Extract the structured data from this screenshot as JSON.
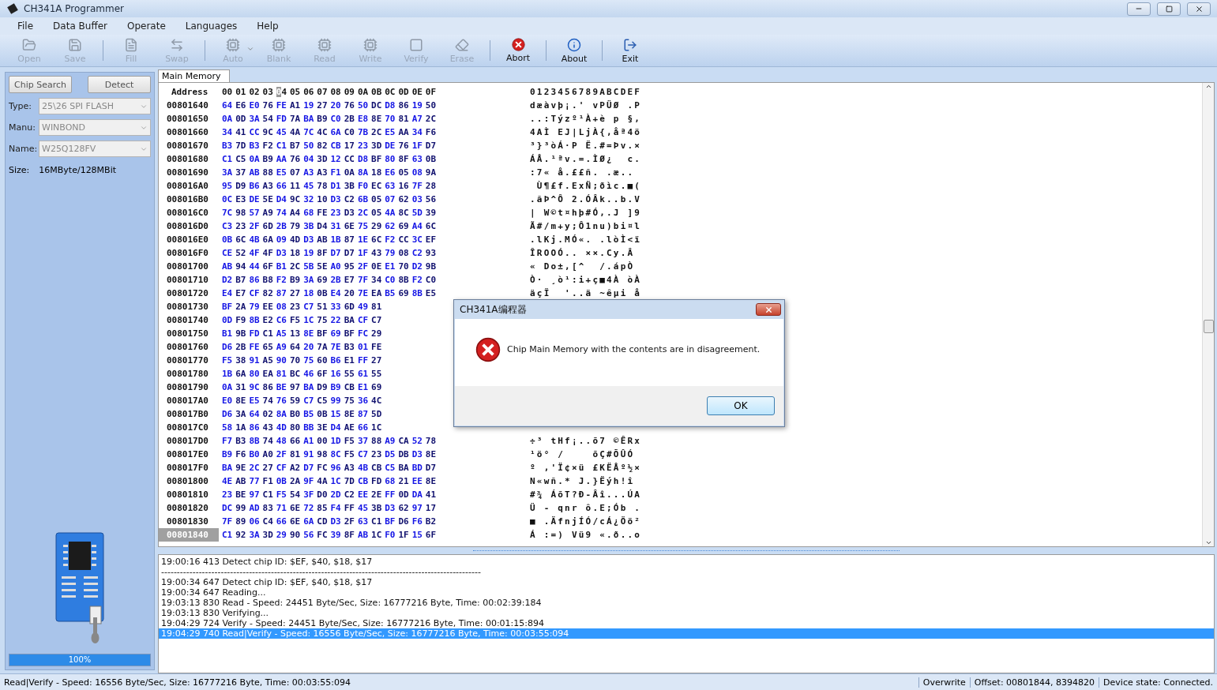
{
  "window": {
    "title": "CH341A Programmer"
  },
  "menu": [
    "File",
    "Data Buffer",
    "Operate",
    "Languages",
    "Help"
  ],
  "toolbar": {
    "groups": [
      {
        "buttons": [
          {
            "label": "Open",
            "disabled": true,
            "kind": "button"
          },
          {
            "label": "Save",
            "disabled": true,
            "kind": "button"
          }
        ]
      },
      {
        "buttons": [
          {
            "label": "Fill",
            "disabled": true,
            "kind": "button"
          },
          {
            "label": "Swap",
            "disabled": true,
            "kind": "button"
          }
        ]
      },
      {
        "buttons": [
          {
            "label": "Auto",
            "disabled": true,
            "kind": "dropdown"
          },
          {
            "label": "Blank",
            "disabled": true,
            "kind": "button"
          },
          {
            "label": "Read",
            "disabled": true,
            "kind": "button"
          },
          {
            "label": "Write",
            "disabled": true,
            "kind": "button"
          },
          {
            "label": "Verify",
            "disabled": true,
            "kind": "button"
          },
          {
            "label": "Erase",
            "disabled": true,
            "kind": "button"
          }
        ]
      },
      {
        "buttons": [
          {
            "label": "Abort",
            "disabled": false,
            "kind": "button"
          }
        ]
      },
      {
        "buttons": [
          {
            "label": "About",
            "disabled": false,
            "kind": "button"
          }
        ]
      },
      {
        "buttons": [
          {
            "label": "Exit",
            "disabled": false,
            "kind": "button"
          }
        ]
      }
    ]
  },
  "chip_panel": {
    "buttons": [
      "Chip Search",
      "Detect"
    ],
    "fields": [
      {
        "label": "Type:",
        "value": "25\\26 SPI FLASH",
        "disabled": true
      },
      {
        "label": "Manu:",
        "value": "WINBOND",
        "disabled": true
      },
      {
        "label": "Name:",
        "value": "W25Q128FV",
        "disabled": true
      }
    ],
    "size_label": "Size:",
    "size_value": "16MByte/128MBit",
    "progress": {
      "level": 1,
      "reading": "100%"
    }
  },
  "hex_view": {
    "tab": "Main Memory",
    "address_header": "Address",
    "ascii_header": "0123456789ABCDEF",
    "columns": [
      {
        "label": "00",
        "cursor": false
      },
      {
        "label": "01",
        "cursor": false
      },
      {
        "label": "02",
        "cursor": false
      },
      {
        "label": "03",
        "cursor": false
      },
      {
        "label": "04",
        "cursor": true
      },
      {
        "label": "05",
        "cursor": false
      },
      {
        "label": "06",
        "cursor": false
      },
      {
        "label": "07",
        "cursor": false
      },
      {
        "label": "08",
        "cursor": false
      },
      {
        "label": "09",
        "cursor": false
      },
      {
        "label": "0A",
        "cursor": false
      },
      {
        "label": "0B",
        "cursor": false
      },
      {
        "label": "0C",
        "cursor": false
      },
      {
        "label": "0D",
        "cursor": false
      },
      {
        "label": "0E",
        "cursor": false
      },
      {
        "label": "0F",
        "cursor": false
      }
    ],
    "rows": [
      {
        "address": "00801640",
        "selected": false,
        "bytes": [
          "64",
          "E6",
          "E0",
          "76",
          "FE",
          "A1",
          "19",
          "27",
          "20",
          "76",
          "50",
          "DC",
          "D8",
          "86",
          "19",
          "50"
        ],
        "ascii": "dæàvþ¡.' vPÜØ .P"
      },
      {
        "address": "00801650",
        "selected": false,
        "bytes": [
          "0A",
          "0D",
          "3A",
          "54",
          "FD",
          "7A",
          "BA",
          "B9",
          "C0",
          "2B",
          "E8",
          "8E",
          "70",
          "81",
          "A7",
          "2C"
        ],
        "ascii": "..:Týzº¹À+è p §,"
      },
      {
        "address": "00801660",
        "selected": false,
        "bytes": [
          "34",
          "41",
          "CC",
          "9C",
          "45",
          "4A",
          "7C",
          "4C",
          "6A",
          "C0",
          "7B",
          "2C",
          "E5",
          "AA",
          "34",
          "F6"
        ],
        "ascii": "4AÌ EJ|LjÀ{,åª4ö"
      },
      {
        "address": "00801670",
        "selected": false,
        "bytes": [
          "B3",
          "7D",
          "B3",
          "F2",
          "C1",
          "B7",
          "50",
          "82",
          "CB",
          "17",
          "23",
          "3D",
          "DE",
          "76",
          "1F",
          "D7"
        ],
        "ascii": "³}³òÁ·P Ë.#=Þv.×"
      },
      {
        "address": "00801680",
        "selected": false,
        "bytes": [
          "C1",
          "C5",
          "0A",
          "B9",
          "AA",
          "76",
          "04",
          "3D",
          "12",
          "CC",
          "D8",
          "BF",
          "80",
          "8F",
          "63",
          "0B"
        ],
        "ascii": "ÁÅ.¹ªv.=.ÌØ¿  c."
      },
      {
        "address": "00801690",
        "selected": false,
        "bytes": [
          "3A",
          "37",
          "AB",
          "88",
          "E5",
          "07",
          "A3",
          "A3",
          "F1",
          "0A",
          "8A",
          "18",
          "E6",
          "05",
          "08",
          "9A"
        ],
        "ascii": ":7« å.££ñ. .æ.."
      },
      {
        "address": "008016A0",
        "selected": false,
        "bytes": [
          "95",
          "D9",
          "B6",
          "A3",
          "66",
          "11",
          "45",
          "78",
          "D1",
          "3B",
          "F0",
          "EC",
          "63",
          "16",
          "7F",
          "28"
        ],
        "ascii": " Ù¶£f.ExÑ;ðìc.■("
      },
      {
        "address": "008016B0",
        "selected": false,
        "bytes": [
          "0C",
          "E3",
          "DE",
          "5E",
          "D4",
          "9C",
          "32",
          "10",
          "D3",
          "C2",
          "6B",
          "05",
          "07",
          "62",
          "03",
          "56"
        ],
        "ascii": ".ãÞ^Ô 2.ÓÂk..b.V"
      },
      {
        "address": "008016C0",
        "selected": false,
        "bytes": [
          "7C",
          "98",
          "57",
          "A9",
          "74",
          "A4",
          "68",
          "FE",
          "23",
          "D3",
          "2C",
          "05",
          "4A",
          "8C",
          "5D",
          "39"
        ],
        "ascii": "| W©t¤hþ#Ó,.J ]9"
      },
      {
        "address": "008016D0",
        "selected": false,
        "bytes": [
          "C3",
          "23",
          "2F",
          "6D",
          "2B",
          "79",
          "3B",
          "D4",
          "31",
          "6E",
          "75",
          "29",
          "62",
          "69",
          "A4",
          "6C"
        ],
        "ascii": "Ã#/m+y;Ô1nu)bi¤l"
      },
      {
        "address": "008016E0",
        "selected": false,
        "bytes": [
          "0B",
          "6C",
          "4B",
          "6A",
          "09",
          "4D",
          "D3",
          "AB",
          "1B",
          "87",
          "1E",
          "6C",
          "F2",
          "CC",
          "3C",
          "EF"
        ],
        "ascii": ".lKj.MÓ«. .lòÌ<ï"
      },
      {
        "address": "008016F0",
        "selected": false,
        "bytes": [
          "CE",
          "52",
          "4F",
          "4F",
          "D3",
          "18",
          "19",
          "8F",
          "D7",
          "D7",
          "1F",
          "43",
          "79",
          "08",
          "C2",
          "93"
        ],
        "ascii": "ÎROOÓ.. ××.Cy.Â"
      },
      {
        "address": "00801700",
        "selected": false,
        "bytes": [
          "AB",
          "94",
          "44",
          "6F",
          "B1",
          "2C",
          "5B",
          "5E",
          "A0",
          "95",
          "2F",
          "0E",
          "E1",
          "70",
          "D2",
          "9B"
        ],
        "ascii": "« Do±,[^  /.ápÒ"
      },
      {
        "address": "00801710",
        "selected": false,
        "bytes": [
          "D2",
          "B7",
          "86",
          "B8",
          "F2",
          "B9",
          "3A",
          "69",
          "2B",
          "E7",
          "7F",
          "34",
          "C0",
          "8B",
          "F2",
          "C0"
        ],
        "ascii": "Ò· ¸ò¹:i+ç■4À òÀ"
      },
      {
        "address": "00801720",
        "selected": false,
        "bytes": [
          "E4",
          "E7",
          "CF",
          "82",
          "87",
          "27",
          "18",
          "0B",
          "E4",
          "20",
          "7E",
          "EA",
          "B5",
          "69",
          "8B",
          "E5"
        ],
        "ascii": "äçÏ  '..ä ~êµi å"
      },
      {
        "address": "00801730",
        "selected": false,
        "bytes": [
          "BF",
          "2A",
          "79",
          "EE",
          "08",
          "23",
          "C7",
          "51",
          "33",
          "6D",
          "49",
          "81"
        ]
      },
      {
        "address": "00801740",
        "selected": false,
        "bytes": [
          "0D",
          "F9",
          "8B",
          "E2",
          "C6",
          "F5",
          "1C",
          "75",
          "22",
          "BA",
          "CF",
          "C7"
        ]
      },
      {
        "address": "00801750",
        "selected": false,
        "bytes": [
          "B1",
          "9B",
          "FD",
          "C1",
          "A5",
          "13",
          "8E",
          "BF",
          "69",
          "BF",
          "FC",
          "29"
        ]
      },
      {
        "address": "00801760",
        "selected": false,
        "bytes": [
          "D6",
          "2B",
          "FE",
          "65",
          "A9",
          "64",
          "20",
          "7A",
          "7E",
          "B3",
          "01",
          "FE"
        ]
      },
      {
        "address": "00801770",
        "selected": false,
        "bytes": [
          "F5",
          "38",
          "91",
          "A5",
          "90",
          "70",
          "75",
          "60",
          "B6",
          "E1",
          "FF",
          "27"
        ]
      },
      {
        "address": "00801780",
        "selected": false,
        "bytes": [
          "1B",
          "6A",
          "80",
          "EA",
          "81",
          "BC",
          "46",
          "6F",
          "16",
          "55",
          "61",
          "55"
        ]
      },
      {
        "address": "00801790",
        "selected": false,
        "bytes": [
          "0A",
          "31",
          "9C",
          "86",
          "BE",
          "97",
          "BA",
          "D9",
          "B9",
          "CB",
          "E1",
          "69"
        ]
      },
      {
        "address": "008017A0",
        "selected": false,
        "bytes": [
          "E0",
          "8E",
          "E5",
          "74",
          "76",
          "59",
          "C7",
          "C5",
          "99",
          "75",
          "36",
          "4C"
        ]
      },
      {
        "address": "008017B0",
        "selected": false,
        "bytes": [
          "D6",
          "3A",
          "64",
          "02",
          "8A",
          "B0",
          "B5",
          "0B",
          "15",
          "8E",
          "87",
          "5D"
        ]
      },
      {
        "address": "008017C0",
        "selected": false,
        "bytes": [
          "58",
          "1A",
          "86",
          "43",
          "4D",
          "80",
          "BB",
          "3E",
          "D4",
          "AE",
          "66",
          "1C"
        ]
      },
      {
        "address": "008017D0",
        "selected": false,
        "bytes": [
          "F7",
          "B3",
          "8B",
          "74",
          "48",
          "66",
          "A1",
          "00",
          "1D",
          "F5",
          "37",
          "88",
          "A9",
          "CA",
          "52",
          "78"
        ],
        "ascii": "÷³ tHf¡..õ7 ©ÊRx"
      },
      {
        "address": "008017E0",
        "selected": false,
        "bytes": [
          "B9",
          "F6",
          "B0",
          "A0",
          "2F",
          "81",
          "91",
          "98",
          "8C",
          "F5",
          "C7",
          "23",
          "D5",
          "DB",
          "D3",
          "8E"
        ],
        "ascii": "¹ö° /    õÇ#ÕÛÓ"
      },
      {
        "address": "008017F0",
        "selected": false,
        "bytes": [
          "BA",
          "9E",
          "2C",
          "27",
          "CF",
          "A2",
          "D7",
          "FC",
          "96",
          "A3",
          "4B",
          "CB",
          "C5",
          "BA",
          "BD",
          "D7"
        ],
        "ascii": "º ,'Ï¢×ü £KËÅº½×"
      },
      {
        "address": "00801800",
        "selected": false,
        "bytes": [
          "4E",
          "AB",
          "77",
          "F1",
          "0B",
          "2A",
          "9F",
          "4A",
          "1C",
          "7D",
          "CB",
          "FD",
          "68",
          "21",
          "EE",
          "8E"
        ],
        "ascii": "N«wñ.* J.}Ëýh!î"
      },
      {
        "address": "00801810",
        "selected": false,
        "bytes": [
          "23",
          "BE",
          "97",
          "C1",
          "F5",
          "54",
          "3F",
          "D0",
          "2D",
          "C2",
          "EE",
          "2E",
          "FF",
          "0D",
          "DA",
          "41"
        ],
        "ascii": "#¾ ÁõT?Ð-Âî...ÚA"
      },
      {
        "address": "00801820",
        "selected": false,
        "bytes": [
          "DC",
          "99",
          "AD",
          "83",
          "71",
          "6E",
          "72",
          "85",
          "F4",
          "FF",
          "45",
          "3B",
          "D3",
          "62",
          "97",
          "17"
        ],
        "ascii": "Ü - qnr ô.E;Ób ."
      },
      {
        "address": "00801830",
        "selected": false,
        "bytes": [
          "7F",
          "89",
          "06",
          "C4",
          "66",
          "6E",
          "6A",
          "CD",
          "D3",
          "2F",
          "63",
          "C1",
          "BF",
          "D6",
          "F6",
          "B2"
        ],
        "ascii": "■ .ÄfnjÍÓ/cÁ¿Öö²"
      },
      {
        "address": "00801840",
        "selected": true,
        "bytes": [
          "C1",
          "92",
          "3A",
          "3D",
          "29",
          "90",
          "56",
          "FC",
          "39",
          "8F",
          "AB",
          "1C",
          "F0",
          "1F",
          "15",
          "6F"
        ],
        "ascii": "Á :=) Vü9 «.ð..o"
      }
    ]
  },
  "log": [
    {
      "text": "19:00:16 413 Detect chip ID: $EF, $40, $18, $17",
      "selected": false
    },
    {
      "text": "------------------------------------------------------------------------------------------------------",
      "selected": false
    },
    {
      "text": "19:00:34 647 Detect chip ID: $EF, $40, $18, $17",
      "selected": false
    },
    {
      "text": "19:00:34 647 Reading...",
      "selected": false
    },
    {
      "text": "19:03:13 830 Read - Speed: 24451 Byte/Sec, Size: 16777216 Byte, Time: 00:02:39:184",
      "selected": false
    },
    {
      "text": "19:03:13 830 Verifying...",
      "selected": false
    },
    {
      "text": "19:04:29 724 Verify - Speed: 24451 Byte/Sec, Size: 16777216 Byte, Time: 00:01:15:894",
      "selected": false
    },
    {
      "text": "19:04:29 740 Read|Verify - Speed: 16556 Byte/Sec, Size: 16777216 Byte, Time: 00:03:55:094",
      "selected": true
    }
  ],
  "status_bar": [
    "Read|Verify - Speed: 16556 Byte/Sec, Size: 16777216 Byte, Time: 00:03:55:094",
    "Overwrite",
    "Offset: 00801844, 8394820",
    "Device state: Connected."
  ],
  "dialog": {
    "title": "CH341A编程器",
    "message": "Chip Main Memory with the contents are in disagreement.",
    "button": "OK"
  }
}
